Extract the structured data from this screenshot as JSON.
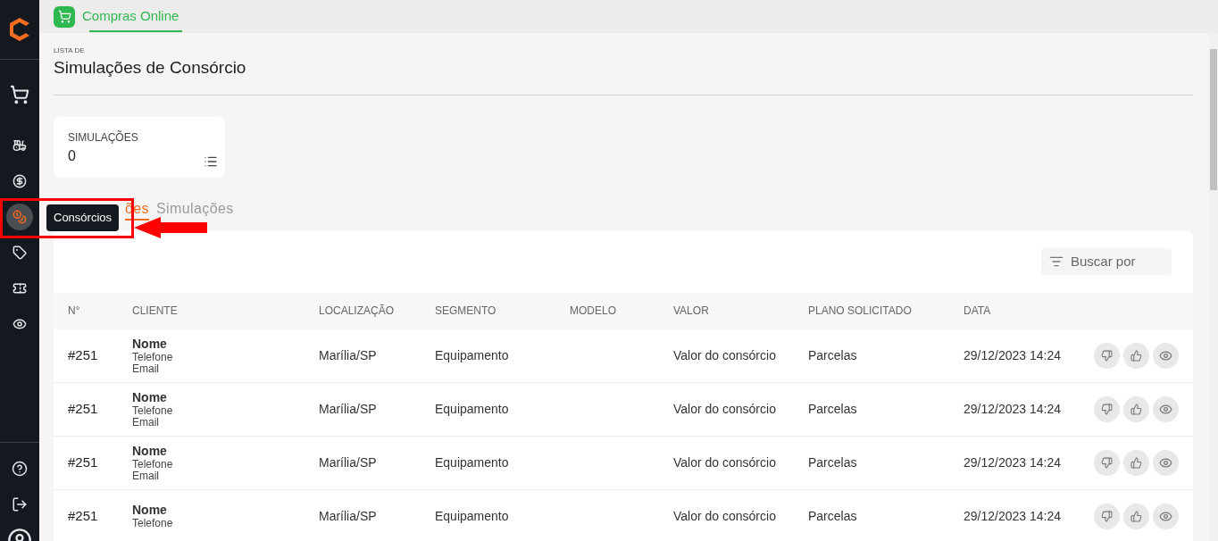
{
  "sidebar": {
    "items": [
      {
        "selected": false
      },
      {
        "selected": false
      },
      {
        "selected": false
      },
      {
        "selected": true
      },
      {
        "selected": false
      },
      {
        "selected": false
      },
      {
        "selected": false
      }
    ]
  },
  "tooltip": {
    "text": "Consórcios"
  },
  "top_tabs": [
    {
      "label": "Compras Online",
      "selected": true
    }
  ],
  "header": {
    "eyebrow": "LISTA DE",
    "title": "Simulações de Consórcio"
  },
  "stat_card": {
    "label": "SIMULAÇÕES",
    "value": "0"
  },
  "tabs": [
    {
      "label": "ões",
      "selected": true
    },
    {
      "label": "Simulações",
      "selected": false
    }
  ],
  "search": {
    "placeholder": "Buscar por"
  },
  "table": {
    "columns": [
      "N°",
      "CLIENTE",
      "LOCALIZAÇÃO",
      "SEGMENTO",
      "MODELO",
      "VALOR",
      "PLANO SOLICITADO",
      "DATA"
    ],
    "rows": [
      {
        "number": "#251",
        "name": "Nome",
        "phone": "Telefone",
        "email": "Email",
        "location": "Marília/SP",
        "segment": "Equipamento",
        "value": "Valor do consórcio",
        "plan": "Parcelas",
        "date": "29/12/2023 14:24"
      },
      {
        "number": "#251",
        "name": "Nome",
        "phone": "Telefone",
        "email": "Email",
        "location": "Marília/SP",
        "segment": "Equipamento",
        "value": "Valor do consórcio",
        "plan": "Parcelas",
        "date": "29/12/2023 14:24"
      },
      {
        "number": "#251",
        "name": "Nome",
        "phone": "Telefone",
        "email": "Email",
        "location": "Marília/SP",
        "segment": "Equipamento",
        "value": "Valor do consórcio",
        "plan": "Parcelas",
        "date": "29/12/2023 14:24"
      },
      {
        "number": "#251",
        "name": "Nome",
        "phone": "Telefone",
        "location": "Marília/SP",
        "segment": "Equipamento",
        "value": "Valor do consórcio",
        "plan": "Parcelas",
        "date": "29/12/2023 14:24"
      }
    ]
  }
}
